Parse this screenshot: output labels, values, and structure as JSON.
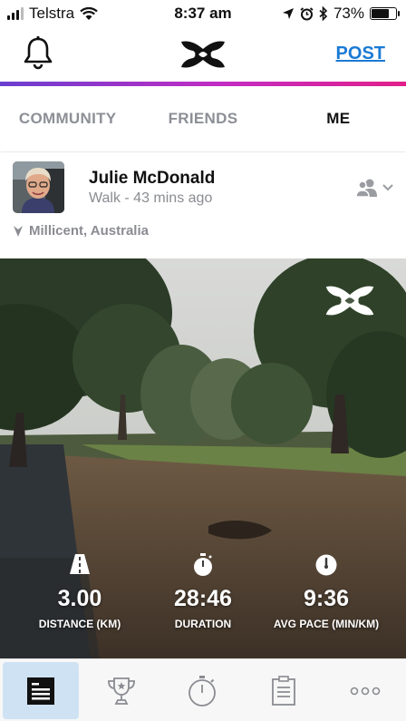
{
  "status_bar": {
    "carrier": "Telstra",
    "time": "8:37 am",
    "battery_percent": "73%",
    "battery_level": 0.73
  },
  "header": {
    "post_label": "POST",
    "accent_gradient": [
      "#6a3fd0",
      "#c42cc4",
      "#e2208a"
    ]
  },
  "tabs": [
    {
      "label": "COMMUNITY",
      "active": false
    },
    {
      "label": "FRIENDS",
      "active": false
    },
    {
      "label": "ME",
      "active": true
    }
  ],
  "post": {
    "user_name": "Julie McDonald",
    "activity_meta": "Walk - 43 mins ago",
    "location": "Millicent, Australia",
    "stats": [
      {
        "icon": "route-icon",
        "value": "3.00",
        "label": "DISTANCE (KM)"
      },
      {
        "icon": "stopwatch-icon",
        "value": "28:46",
        "label": "DURATION"
      },
      {
        "icon": "speedometer-icon",
        "value": "9:36",
        "label": "AVG PACE (MIN/KM)"
      }
    ]
  },
  "bottom_nav": [
    {
      "icon": "feed-icon",
      "active": true
    },
    {
      "icon": "trophy-icon",
      "active": false
    },
    {
      "icon": "stopwatch-icon",
      "active": false
    },
    {
      "icon": "clipboard-icon",
      "active": false
    },
    {
      "icon": "more-icon",
      "active": false
    }
  ],
  "colors": {
    "link_blue": "#1a7ad4",
    "inactive_tab": "#8c8f96",
    "active_nav_bg": "#cfe2f3"
  }
}
